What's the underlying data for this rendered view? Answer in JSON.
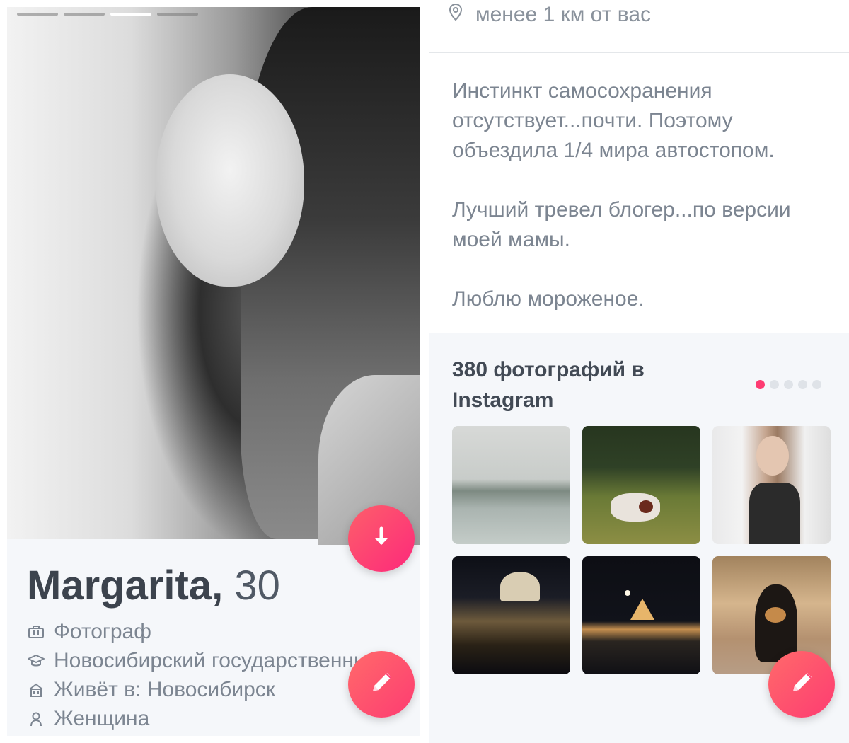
{
  "profile": {
    "name": "Margarita,",
    "age": "30",
    "photo_count": 4,
    "active_photo_index": 2,
    "details": [
      {
        "icon": "briefcase-icon",
        "text": "Фотограф"
      },
      {
        "icon": "graduation-cap-icon",
        "text": "Новосибирский государственный"
      },
      {
        "icon": "house-icon",
        "text": "Живёт в: Новосибирск"
      },
      {
        "icon": "person-icon",
        "text": "Женщина"
      }
    ]
  },
  "right": {
    "distance": "менее 1 км от вас",
    "bio": [
      "Инстинкт самосохранения отсутствует...почти. Поэтому объездила 1/4 мира автостопом.",
      "Лучший тревел блогер...по версии моей мамы.",
      "Люблю мороженое."
    ],
    "instagram_title": "380 фотографий в Instagram",
    "instagram_pages": 5,
    "instagram_active_page": 0,
    "instagram_tiles": [
      "lake-fog",
      "horse-meadow",
      "woman-portrait",
      "venice-night",
      "louvre-night",
      "dog-portrait"
    ]
  },
  "colors": {
    "accent": "#fe3c72",
    "accent_gradient_start": "#fd5f6a",
    "text_primary": "#3c434d",
    "text_secondary": "#7c8591"
  }
}
